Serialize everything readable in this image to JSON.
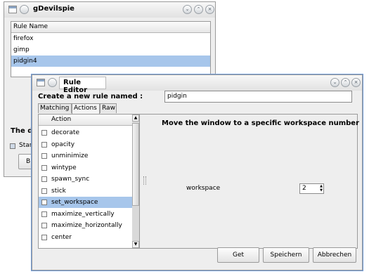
{
  "main_window": {
    "title": "gDevilspie",
    "rules_header": "Rule Name",
    "rules": [
      "firefox",
      "gimp",
      "pidgin4"
    ],
    "selected_rule": "pidgin4",
    "partial_text": "The d",
    "partial_checkbox_label": "Star",
    "partial_button_label": "B"
  },
  "editor": {
    "title": "Rule Editor",
    "create_label": "Create a new rule named :",
    "rule_name_value": "pidgin",
    "tabs": [
      {
        "label": "Matching",
        "active": false
      },
      {
        "label": "Actions",
        "active": true
      },
      {
        "label": "Raw",
        "active": false
      }
    ],
    "actions_header": "Action",
    "actions": [
      {
        "label": "decorate",
        "checked": false,
        "selected": false
      },
      {
        "label": "opacity",
        "checked": false,
        "selected": false
      },
      {
        "label": "unminimize",
        "checked": false,
        "selected": false
      },
      {
        "label": "wintype",
        "checked": false,
        "selected": false
      },
      {
        "label": "spawn_sync",
        "checked": false,
        "selected": false
      },
      {
        "label": "stick",
        "checked": false,
        "selected": false
      },
      {
        "label": "set_workspace",
        "checked": false,
        "selected": true
      },
      {
        "label": "maximize_vertically",
        "checked": false,
        "selected": false
      },
      {
        "label": "maximize_horizontally",
        "checked": false,
        "selected": false
      },
      {
        "label": "center",
        "checked": false,
        "selected": false
      }
    ],
    "detail_heading": "Move the window to a specific workspace number",
    "workspace_label": "workspace",
    "workspace_value": "2",
    "buttons": {
      "get": "Get",
      "save": "Speichern",
      "cancel": "Abbrechen"
    }
  },
  "colors": {
    "selection": "#a7c6eb",
    "window_bg": "#eeeeee"
  }
}
